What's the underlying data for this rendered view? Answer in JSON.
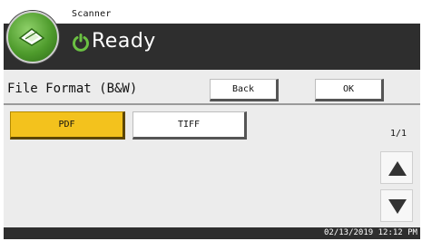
{
  "header": {
    "app_name": "Scanner",
    "status": "Ready"
  },
  "title_row": {
    "label": "File Format (B&W)",
    "back_label": "Back",
    "ok_label": "OK"
  },
  "formats": [
    {
      "label": "PDF",
      "selected": true
    },
    {
      "label": "TIFF",
      "selected": false
    }
  ],
  "pagination": {
    "indicator": "1/1"
  },
  "footer": {
    "datetime": "02/13/2019 12:12 PM"
  },
  "colors": {
    "selected_bg": "#f3c21d",
    "header_bg": "#2e2e2e",
    "status_green": "#6bc143"
  },
  "icons": {
    "app": "scanner-icon",
    "status": "ready-power-icon",
    "up": "arrow-up-icon",
    "down": "arrow-down-icon"
  }
}
